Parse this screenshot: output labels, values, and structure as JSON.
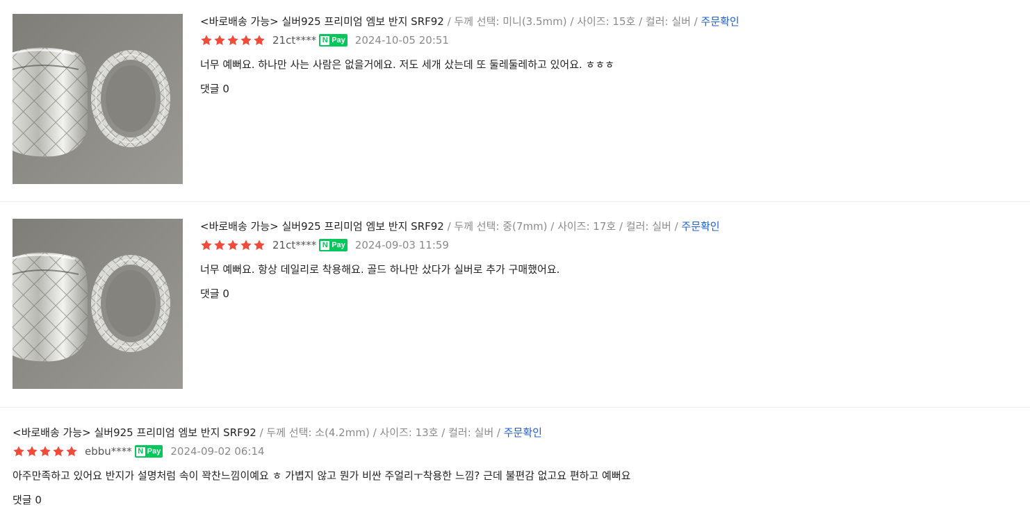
{
  "reviews": [
    {
      "product_name": "<바로배송 가능> 실버925 프리미엄 엠보 반지 SRF92",
      "option_text": " / 두께 선택: 미니(3.5mm) / 사이즈: 15호 / 컬러: 실버 / ",
      "order_link": "주문확인",
      "rating": 5,
      "user": "21ct****",
      "pay_badge": "Pay",
      "pay_badge_n": "N",
      "date": "2024-10-05 20:51",
      "body": "너무 예뻐요. 하나만 사는 사람은 없을거에요. 저도 세개 샀는데 또 둘레둘레하고 있어요. ㅎㅎㅎ",
      "comments": "댓글 0",
      "photo": "silver-rings-photo"
    },
    {
      "product_name": "<바로배송 가능> 실버925 프리미엄 엠보 반지 SRF92",
      "option_text": " / 두께 선택: 중(7mm) / 사이즈: 17호 / 컬러: 실버 / ",
      "order_link": "주문확인",
      "rating": 5,
      "user": "21ct****",
      "pay_badge": "Pay",
      "pay_badge_n": "N",
      "date": "2024-09-03 11:59",
      "body": "너무 예뻐요. 항상 데일리로 착용해요. 골드 하나만 샀다가 실버로 추가 구매했어요.",
      "comments": "댓글 0",
      "photo": "silver-rings-photo"
    },
    {
      "product_name": "<바로배송 가능> 실버925 프리미엄 엠보 반지 SRF92",
      "option_text": " / 두께 선택: 소(4.2mm) / 사이즈: 13호 / 컬러: 실버 / ",
      "order_link": "주문확인",
      "rating": 5,
      "user": "ebbu****",
      "pay_badge": "Pay",
      "pay_badge_n": "N",
      "date": "2024-09-02 06:14",
      "body": "아주만족하고 있어요 반지가 설명처럼 속이 꽉찬느낌이예요 ㅎ 가볍지 않고 뭔가 비싼 주얼리ㅜ착용한 느낌? 근데 불편감 없고요 편하고 예뻐요",
      "comments": "댓글 0"
    }
  ],
  "colors": {
    "star": "#f04a3a",
    "npay": "#03c75a",
    "link": "#1a5fd6"
  }
}
